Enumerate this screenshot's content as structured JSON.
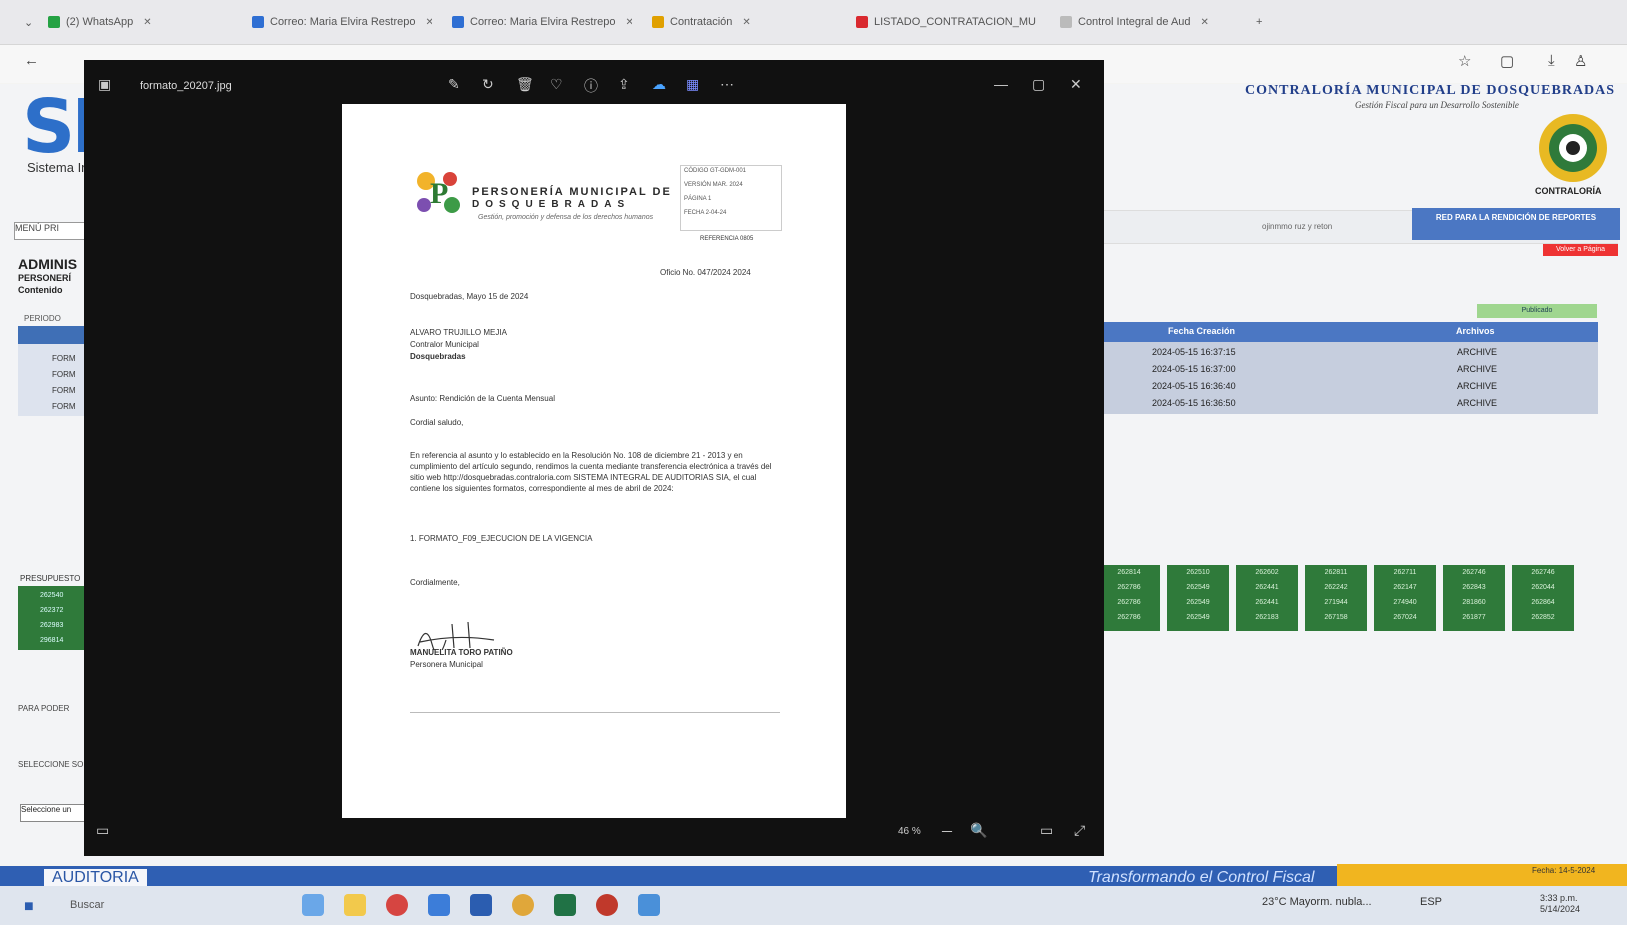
{
  "browser": {
    "tabs": [
      {
        "label": "(2) WhatsApp",
        "color": "#25a244"
      },
      {
        "label": "Correo: Maria Elvira Restrepo",
        "color": "#2f6fd3"
      },
      {
        "label": "Correo: Maria Elvira Restrepo",
        "color": "#2f6fd3"
      },
      {
        "label": "Contratación",
        "color": "#e0a000"
      },
      {
        "label": "LISTADO_CONTRATACION_MU",
        "color": "#d9292f"
      },
      {
        "label": "Control Integral de Aud",
        "color": "#888888"
      }
    ]
  },
  "site": {
    "logo": "SI",
    "subtitle": "Sistema In",
    "menu_field": "MENÚ PRI",
    "admin_title": "ADMINIS",
    "admin_line2": "PERSONERÍ",
    "admin_line3": "Contenido",
    "period_label": "PERIODO",
    "left_rows": [
      "FORM",
      "FORM",
      "FORM",
      "FORM"
    ],
    "org_name": "CONTRALORÍA MUNICIPAL DE DOSQUEBRADAS",
    "org_slogan": "Gestión Fiscal para un Desarrollo Sostenible",
    "seal_label": "CONTRALORÍA",
    "nav_mid": "ojinmmo ruz y reton",
    "nav_button": "RED PARA LA RENDICIÓN DE REPORTES",
    "nav_red": "Volver a Página",
    "green_small": "Publicado",
    "table_headers": [
      "Fecha Creación",
      "Archivos"
    ],
    "table_rows": [
      {
        "date": "2024-05-15 16:37:15",
        "file": "ARCHIVE"
      },
      {
        "date": "2024-05-15 16:37:00",
        "file": "ARCHIVE"
      },
      {
        "date": "2024-05-15 16:36:40",
        "file": "ARCHIVE"
      },
      {
        "date": "2024-05-15 16:36:50",
        "file": "ARCHIVE"
      }
    ],
    "left_green_label": "PRESUPUESTO",
    "left_green_rows": [
      "262540",
      "262372",
      "262983",
      "296814"
    ],
    "green_cols": [
      [
        "262814",
        "262786",
        "262786",
        "262786"
      ],
      [
        "262510",
        "262549",
        "262549",
        "262549"
      ],
      [
        "262602",
        "262441",
        "262441",
        "262183"
      ],
      [
        "262811",
        "262242",
        "271944",
        "267158"
      ],
      [
        "262711",
        "262147",
        "274940",
        "267024"
      ],
      [
        "262746",
        "262843",
        "281860",
        "261877"
      ],
      [
        "262746",
        "262044",
        "262864",
        "262852"
      ]
    ],
    "left_low1": "PARA PODER",
    "left_low2": "SELECCIONE SOLO DOCUM",
    "left_select": "Seleccione un",
    "audit_label": "AUDITORIA",
    "audit_slogan": "Transformando el Control Fiscal",
    "audit_date": "Fecha: 14-5-2024"
  },
  "viewer": {
    "filename": "formato_20207.jpg",
    "zoom": "46 %",
    "doc": {
      "org_line1": "PERSONERÍA MUNICIPAL DE",
      "org_line2": "DOSQUEBRADAS",
      "org_slogan": "Gestión, promoción y defensa de los derechos humanos",
      "meta_rows": [
        "CÓDIGO   GT-GDM-001",
        "VERSIÓN   MAR. 2024",
        "PÁGINA   1",
        "FECHA   2-04-24"
      ],
      "meta_footer": "REFERENCIA 0805",
      "ref": "Oficio No. 047/2024 2024",
      "date_line": "Dosquebradas, Mayo 15 de 2024",
      "addressee": [
        "ALVARO TRUJILLO MEJIA",
        "Contralor Municipal",
        "Dosquebradas"
      ],
      "subject": "Asunto: Rendición de la Cuenta Mensual",
      "greeting": "Cordial saludo,",
      "body": "En referencia al asunto y lo establecido en la Resolución No. 108 de diciembre 21 - 2013 y en cumplimiento del artículo segundo, rendimos la cuenta mediante transferencia electrónica a través del sitio web http://dosquebradas.contraloria.com SISTEMA INTEGRAL DE AUDITORIAS SIA, el cual contiene los siguientes formatos, correspondiente al mes de abril de 2024:",
      "item": "1. FORMATO_F09_EJECUCION DE LA VIGENCIA",
      "closing": "Cordialmente,",
      "signer": "MANUELITA TORO PATIÑO",
      "signer_title": "Personera Municipal"
    }
  },
  "taskbar": {
    "search": "Buscar",
    "weather": "23°C Mayorm. nubla...",
    "time": "3:33 p.m.",
    "date": "5/14/2024",
    "lang": "ESP"
  }
}
